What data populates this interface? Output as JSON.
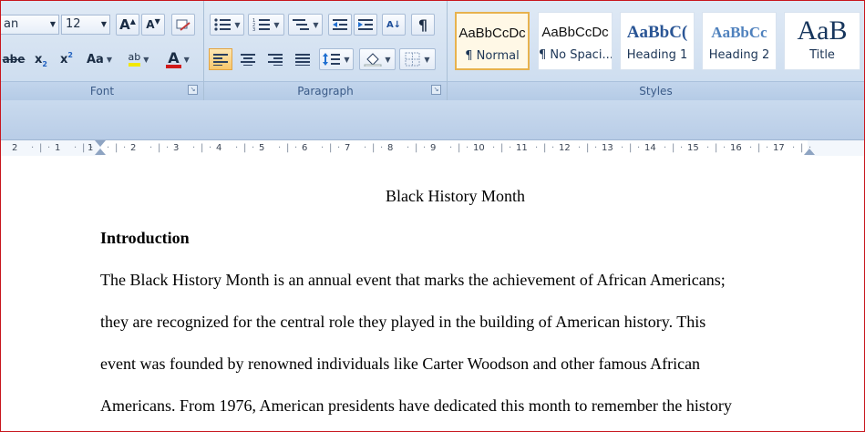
{
  "font_group": {
    "font_name": "an",
    "font_size": "12",
    "grow_label": "A",
    "shrink_label": "A",
    "strike_label": "abe",
    "subscript_label": "x",
    "superscript_label": "x",
    "case_label": "Aa",
    "highlight_label": "ab",
    "font_color_label": "A",
    "label": "Font"
  },
  "paragraph_group": {
    "sort_label": "A↓",
    "pilcrow_label": "¶",
    "label": "Paragraph"
  },
  "styles_group": {
    "label": "Styles",
    "items": [
      {
        "sample": "AaBbCcDc",
        "name": "¶ Normal"
      },
      {
        "sample": "AaBbCcDc",
        "name": "¶ No Spaci..."
      },
      {
        "sample": "AaBbC(",
        "name": "Heading 1"
      },
      {
        "sample": "AaBbCc",
        "name": "Heading 2"
      },
      {
        "sample": "AaB",
        "name": "Title"
      }
    ]
  },
  "ruler": {
    "ticks": [
      "2",
      "1",
      "1",
      "2",
      "3",
      "4",
      "5",
      "6",
      "7",
      "8",
      "9",
      "10",
      "11",
      "12",
      "13",
      "14",
      "15",
      "16",
      "17"
    ]
  },
  "document": {
    "title": "Black History Month",
    "heading": "Introduction",
    "lines": [
      "The Black History Month is an annual event that marks the achievement of African Americans;",
      "they are recognized for the central role they played in the building of American history. This",
      "event was founded by renowned individuals like Carter Woodson and other famous African",
      "Americans. From 1976, American presidents have dedicated this month to remember the history"
    ]
  },
  "colors": {
    "highlight": "#f2e800",
    "font_color": "#d01a1a",
    "frame": "#c8161d"
  }
}
